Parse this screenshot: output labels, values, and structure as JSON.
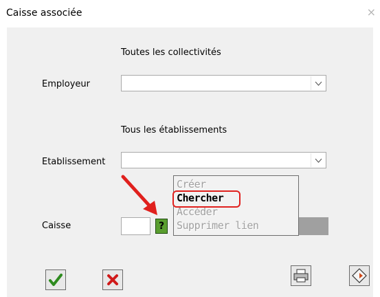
{
  "window": {
    "title": "Caisse associée",
    "close_glyph": "×"
  },
  "employeur": {
    "caption": "Toutes les collectivités",
    "label": "Employeur",
    "value": ""
  },
  "etablissement": {
    "caption": "Tous les établissements",
    "label": "Etablissement",
    "value": ""
  },
  "caisse": {
    "label": "Caisse",
    "value": "",
    "help_glyph": "?"
  },
  "context_menu": {
    "items": [
      {
        "label": "Créer",
        "enabled": false
      },
      {
        "label": "Chercher",
        "enabled": true,
        "highlighted": true
      },
      {
        "label": "Accéder",
        "enabled": false
      },
      {
        "label": "Supprimer lien",
        "enabled": false
      }
    ]
  },
  "toolbar": {
    "ok_icon": "checkmark-icon",
    "cancel_icon": "red-x-icon",
    "print_icon": "printer-icon",
    "export_icon": "diamond-export-icon"
  },
  "colors": {
    "highlight_border": "#e0201d",
    "annotation_arrow": "#e0201d",
    "help_button": "#5a9e2f"
  }
}
